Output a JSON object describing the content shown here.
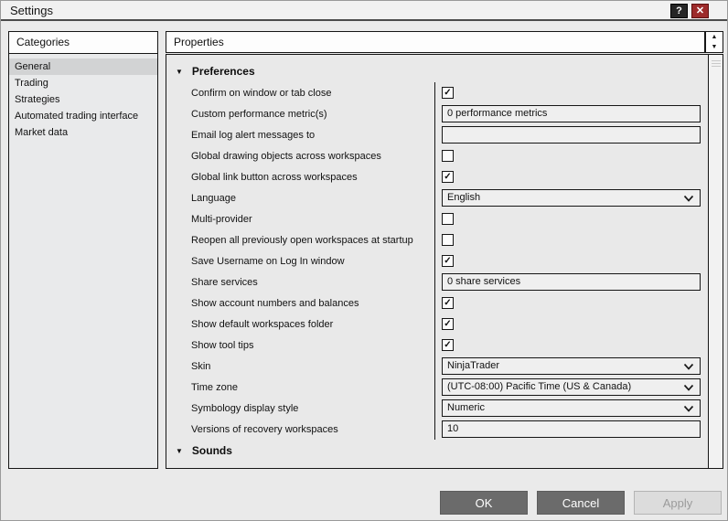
{
  "window": {
    "title": "Settings",
    "help_button": "?",
    "close_button": "✕"
  },
  "icons": {
    "up_arrow": "▲",
    "down_arrow": "▼",
    "section_expanded": "▼",
    "check": "✓"
  },
  "categories": {
    "header": "Categories",
    "items": [
      {
        "label": "General",
        "selected": true
      },
      {
        "label": "Trading",
        "selected": false
      },
      {
        "label": "Strategies",
        "selected": false
      },
      {
        "label": "Automated trading interface",
        "selected": false
      },
      {
        "label": "Market data",
        "selected": false
      }
    ]
  },
  "properties": {
    "header": "Properties",
    "sections": [
      {
        "label": "Preferences",
        "expanded": true,
        "rows": [
          {
            "label": "Confirm on window or tab close",
            "type": "checkbox",
            "checked": true
          },
          {
            "label": "Custom performance metric(s)",
            "type": "text",
            "value": "0 performance metrics"
          },
          {
            "label": "Email log alert messages to",
            "type": "text",
            "value": ""
          },
          {
            "label": "Global drawing objects across workspaces",
            "type": "checkbox",
            "checked": false
          },
          {
            "label": "Global link button across workspaces",
            "type": "checkbox",
            "checked": true
          },
          {
            "label": "Language",
            "type": "select",
            "value": "English"
          },
          {
            "label": "Multi-provider",
            "type": "checkbox",
            "checked": false
          },
          {
            "label": "Reopen all previously open workspaces at startup",
            "type": "checkbox",
            "checked": false
          },
          {
            "label": "Save Username on Log In window",
            "type": "checkbox",
            "checked": true
          },
          {
            "label": "Share services",
            "type": "text",
            "value": "0 share services"
          },
          {
            "label": "Show account numbers and balances",
            "type": "checkbox",
            "checked": true
          },
          {
            "label": "Show default workspaces folder",
            "type": "checkbox",
            "checked": true
          },
          {
            "label": "Show tool tips",
            "type": "checkbox",
            "checked": true
          },
          {
            "label": "Skin",
            "type": "select",
            "value": "NinjaTrader"
          },
          {
            "label": "Time zone",
            "type": "select",
            "value": "(UTC-08:00) Pacific Time (US & Canada)"
          },
          {
            "label": "Symbology display style",
            "type": "select",
            "value": "Numeric"
          },
          {
            "label": "Versions of recovery workspaces",
            "type": "text",
            "value": "10"
          }
        ]
      },
      {
        "label": "Sounds",
        "expanded": true,
        "rows": []
      }
    ]
  },
  "footer": {
    "ok_label": "OK",
    "cancel_label": "Cancel",
    "apply_label": "Apply"
  },
  "colors": {
    "titlebar_bg": "#f1f1f1",
    "dialog_bg": "#eaeaea",
    "panel_header_bg": "#fdfdfd",
    "grid_bg": "#e9e9e9",
    "selected_item_bg": "#d2d3d4",
    "field_bg": "#efefef",
    "border_dark": "#161616",
    "button_bg": "#6b6b6b",
    "button_text": "#ffffff",
    "button_disabled_bg": "#dcdcdc",
    "button_disabled_text": "#9b9b9b",
    "close_button_bg": "#9d2b2b",
    "help_button_bg": "#262626"
  }
}
